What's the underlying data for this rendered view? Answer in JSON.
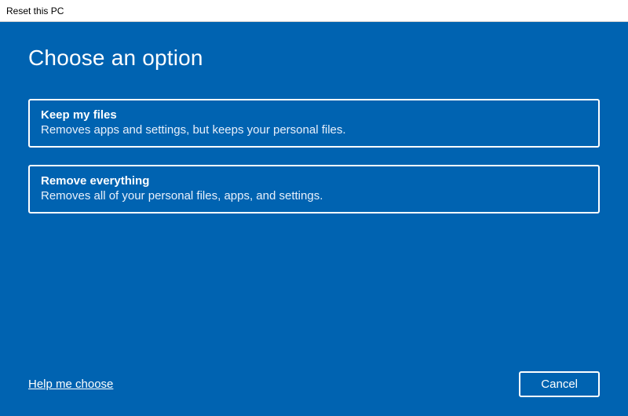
{
  "window": {
    "title": "Reset this PC"
  },
  "heading": "Choose an option",
  "options": {
    "keep": {
      "title": "Keep my files",
      "desc": "Removes apps and settings, but keeps your personal files."
    },
    "remove": {
      "title": "Remove everything",
      "desc": "Removes all of your personal files, apps, and settings."
    }
  },
  "footer": {
    "help": "Help me choose",
    "cancel": "Cancel"
  },
  "colors": {
    "accent": "#0063B1"
  }
}
